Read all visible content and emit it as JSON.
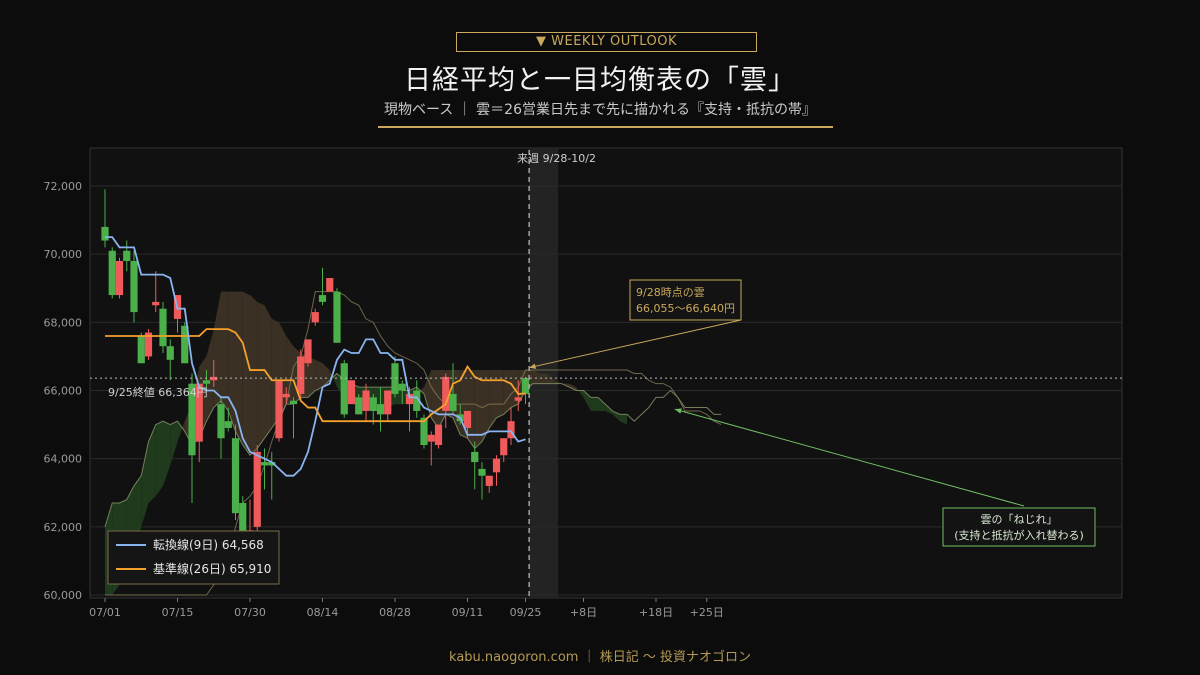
{
  "header": {
    "badge": "▼ WEEKLY OUTLOOK",
    "title": "日経平均と一目均衡表の「雲」",
    "subtitle": "現物ベース ｜ 雲＝26営業日先まで先に描かれる『支持・抵抗の帯』"
  },
  "footer": "kabu.naogoron.com ｜ 株日記 〜 投資ナオゴロン",
  "colors": {
    "up": "#f05a5a",
    "down": "#4cb04a",
    "tenkan": "#8ab4f0",
    "kijun": "#f5a02a",
    "bear_cloud": "#3a3124",
    "bull_cloud": "#1f3a1c",
    "accent": "#c9a95d"
  },
  "chart_data": {
    "type": "candlestick",
    "y_ticks": [
      "72,000",
      "70,000",
      "68,000",
      "66,000",
      "64,000",
      "62,000",
      "60,000"
    ],
    "ylim": [
      60000,
      73000
    ],
    "x_ticks": [
      {
        "label": "07/01",
        "i": 0
      },
      {
        "label": "07/15",
        "i": 10
      },
      {
        "label": "07/30",
        "i": 20
      },
      {
        "label": "08/14",
        "i": 30
      },
      {
        "label": "08/28",
        "i": 40
      },
      {
        "label": "09/11",
        "i": 50
      },
      {
        "label": "09/25",
        "i": 58
      },
      {
        "label": "+8日",
        "i": 66
      },
      {
        "label": "+18日",
        "i": 76
      },
      {
        "label": "+25日",
        "i": 83
      }
    ],
    "x_count": 85,
    "candles": [
      [
        70800,
        71900,
        70200,
        70400
      ],
      [
        70100,
        70200,
        68700,
        68800
      ],
      [
        68800,
        69900,
        68700,
        69800
      ],
      [
        70100,
        70400,
        69500,
        69800
      ],
      [
        69800,
        70100,
        68000,
        68300
      ],
      [
        67600,
        67700,
        66800,
        66800
      ],
      [
        67000,
        67800,
        66900,
        67700
      ],
      [
        68500,
        69500,
        68300,
        68600
      ],
      [
        68400,
        68600,
        67100,
        67300
      ],
      [
        67300,
        67500,
        66300,
        66900
      ],
      [
        68100,
        68800,
        67700,
        68800
      ],
      [
        67900,
        68000,
        66800,
        66800
      ],
      [
        66200,
        66500,
        62700,
        64100
      ],
      [
        64500,
        66200,
        63900,
        66200
      ],
      [
        66300,
        66600,
        66000,
        66200
      ],
      [
        66300,
        66900,
        66100,
        66400
      ],
      [
        65600,
        65800,
        64000,
        64600
      ],
      [
        65100,
        65500,
        64800,
        64900
      ],
      [
        64600,
        65000,
        62200,
        62400
      ],
      [
        62700,
        62900,
        60500,
        61800
      ],
      [
        61200,
        62800,
        60900,
        61900
      ],
      [
        62000,
        64400,
        61700,
        64200
      ],
      [
        63900,
        64300,
        63100,
        63800
      ],
      [
        63900,
        64200,
        62800,
        63800
      ],
      [
        64600,
        66300,
        64500,
        66300
      ],
      [
        65800,
        66100,
        65600,
        65900
      ],
      [
        65700,
        65800,
        64600,
        65600
      ],
      [
        65900,
        67200,
        65700,
        67000
      ],
      [
        66800,
        67500,
        66700,
        67500
      ],
      [
        68000,
        68400,
        67900,
        68300
      ],
      [
        68800,
        69600,
        68500,
        68600
      ],
      [
        68900,
        69300,
        68900,
        69300
      ],
      [
        68900,
        69000,
        67400,
        67400
      ],
      [
        66800,
        66900,
        65200,
        65300
      ],
      [
        65600,
        66300,
        65600,
        66300
      ],
      [
        65800,
        65900,
        65300,
        65300
      ],
      [
        65400,
        66200,
        65100,
        66000
      ],
      [
        65800,
        65900,
        65000,
        65400
      ],
      [
        65600,
        66100,
        64800,
        65300
      ],
      [
        65300,
        66000,
        65100,
        66000
      ],
      [
        66800,
        67000,
        65800,
        65900
      ],
      [
        66200,
        66300,
        65600,
        66000
      ],
      [
        65600,
        66100,
        64800,
        65900
      ],
      [
        66000,
        66300,
        65200,
        65400
      ],
      [
        65200,
        65300,
        64300,
        64400
      ],
      [
        64500,
        64800,
        63800,
        64700
      ],
      [
        64400,
        65000,
        64300,
        65000
      ],
      [
        65400,
        66500,
        64900,
        66400
      ],
      [
        65900,
        66800,
        65300,
        65400
      ],
      [
        65300,
        65600,
        65000,
        65100
      ],
      [
        64900,
        65400,
        64600,
        65400
      ],
      [
        64200,
        64500,
        63100,
        63900
      ],
      [
        63700,
        63900,
        62800,
        63500
      ],
      [
        63200,
        63400,
        63000,
        63500
      ],
      [
        63600,
        64100,
        63200,
        64000
      ],
      [
        64100,
        64600,
        63900,
        64600
      ],
      [
        64600,
        65500,
        64400,
        65100
      ],
      [
        65700,
        66300,
        65400,
        65800
      ],
      [
        66364,
        66400,
        65600,
        65900
      ]
    ],
    "tenkan": [
      [
        0,
        70500
      ],
      [
        1,
        70500
      ],
      [
        2,
        70200
      ],
      [
        3,
        70200
      ],
      [
        4,
        70200
      ],
      [
        5,
        69400
      ],
      [
        8,
        69400
      ],
      [
        9,
        69300
      ],
      [
        10,
        68400
      ],
      [
        11,
        68400
      ],
      [
        12,
        66800
      ],
      [
        13,
        66100
      ],
      [
        14,
        66000
      ],
      [
        15,
        66000
      ],
      [
        16,
        65800
      ],
      [
        17,
        65800
      ],
      [
        18,
        65400
      ],
      [
        19,
        64600
      ],
      [
        20,
        64200
      ],
      [
        21,
        64100
      ],
      [
        22,
        64000
      ],
      [
        23,
        63900
      ],
      [
        24,
        63700
      ],
      [
        25,
        63500
      ],
      [
        26,
        63500
      ],
      [
        27,
        63700
      ],
      [
        28,
        64200
      ],
      [
        29,
        65100
      ],
      [
        30,
        66100
      ],
      [
        31,
        66200
      ],
      [
        32,
        66900
      ],
      [
        33,
        67200
      ],
      [
        34,
        67100
      ],
      [
        35,
        67100
      ],
      [
        36,
        67500
      ],
      [
        37,
        67500
      ],
      [
        38,
        67100
      ],
      [
        39,
        67100
      ],
      [
        40,
        66900
      ],
      [
        41,
        66900
      ],
      [
        42,
        65800
      ],
      [
        43,
        65800
      ],
      [
        44,
        65500
      ],
      [
        45,
        65400
      ],
      [
        46,
        65300
      ],
      [
        47,
        65300
      ],
      [
        48,
        65300
      ],
      [
        49,
        65200
      ],
      [
        50,
        64700
      ],
      [
        51,
        64700
      ],
      [
        52,
        64700
      ],
      [
        53,
        64800
      ],
      [
        54,
        64800
      ],
      [
        55,
        64800
      ],
      [
        56,
        64800
      ],
      [
        57,
        64500
      ],
      [
        58,
        64568
      ]
    ],
    "kijun": [
      [
        0,
        67600
      ],
      [
        13,
        67600
      ],
      [
        14,
        67800
      ],
      [
        17,
        67800
      ],
      [
        18,
        67700
      ],
      [
        19,
        67400
      ],
      [
        20,
        66600
      ],
      [
        22,
        66600
      ],
      [
        23,
        66300
      ],
      [
        26,
        66300
      ],
      [
        27,
        65700
      ],
      [
        28,
        65500
      ],
      [
        29,
        65500
      ],
      [
        30,
        65100
      ],
      [
        44,
        65100
      ],
      [
        45,
        65300
      ],
      [
        47,
        65600
      ],
      [
        48,
        66200
      ],
      [
        49,
        66300
      ],
      [
        50,
        66700
      ],
      [
        51,
        66400
      ],
      [
        52,
        66300
      ],
      [
        55,
        66300
      ],
      [
        56,
        66200
      ],
      [
        57,
        65900
      ],
      [
        58,
        65910
      ]
    ],
    "senkou_a": [
      [
        0,
        62000
      ],
      [
        1,
        62700
      ],
      [
        2,
        62700
      ],
      [
        3,
        62800
      ],
      [
        4,
        63200
      ],
      [
        5,
        63500
      ],
      [
        6,
        64500
      ],
      [
        7,
        65000
      ],
      [
        8,
        65100
      ],
      [
        9,
        65000
      ],
      [
        10,
        65100
      ],
      [
        11,
        64800
      ],
      [
        12,
        64400
      ],
      [
        13,
        64600
      ],
      [
        14,
        65100
      ],
      [
        15,
        65500
      ],
      [
        16,
        65700
      ],
      [
        17,
        65400
      ],
      [
        18,
        64800
      ],
      [
        19,
        64400
      ],
      [
        20,
        64100
      ],
      [
        21,
        64300
      ],
      [
        22,
        64600
      ],
      [
        23,
        64900
      ],
      [
        24,
        65200
      ],
      [
        25,
        65600
      ],
      [
        26,
        65600
      ],
      [
        27,
        65800
      ],
      [
        28,
        65800
      ],
      [
        29,
        66000
      ],
      [
        30,
        66100
      ],
      [
        31,
        66300
      ],
      [
        32,
        66500
      ],
      [
        33,
        66300
      ],
      [
        34,
        66200
      ],
      [
        35,
        66100
      ],
      [
        36,
        66100
      ],
      [
        37,
        66100
      ],
      [
        38,
        66100
      ],
      [
        39,
        66100
      ],
      [
        40,
        66100
      ],
      [
        41,
        66000
      ],
      [
        42,
        66000
      ],
      [
        43,
        66100
      ],
      [
        44,
        65900
      ],
      [
        45,
        65200
      ],
      [
        46,
        64900
      ],
      [
        47,
        65300
      ],
      [
        48,
        65200
      ],
      [
        49,
        64700
      ],
      [
        50,
        64600
      ],
      [
        51,
        64300
      ],
      [
        52,
        64500
      ],
      [
        53,
        64900
      ],
      [
        54,
        65200
      ],
      [
        55,
        65300
      ],
      [
        56,
        65500
      ],
      [
        57,
        65600
      ],
      [
        58,
        66000
      ],
      [
        59,
        66200
      ],
      [
        60,
        66200
      ],
      [
        61,
        66200
      ],
      [
        62,
        66200
      ],
      [
        63,
        66200
      ],
      [
        64,
        66100
      ],
      [
        65,
        66000
      ],
      [
        66,
        66000
      ],
      [
        67,
        65800
      ],
      [
        68,
        65800
      ],
      [
        69,
        65600
      ],
      [
        70,
        65400
      ],
      [
        71,
        65300
      ],
      [
        72,
        65300
      ],
      [
        73,
        65100
      ],
      [
        74,
        65300
      ],
      [
        75,
        65500
      ],
      [
        76,
        65800
      ],
      [
        77,
        65800
      ],
      [
        78,
        66000
      ],
      [
        79,
        65800
      ],
      [
        80,
        65500
      ],
      [
        81,
        65500
      ],
      [
        82,
        65500
      ],
      [
        83,
        65500
      ],
      [
        84,
        65300
      ],
      [
        85,
        65300
      ]
    ],
    "senkou_b": [
      [
        0,
        60000
      ],
      [
        14,
        60000
      ],
      [
        15,
        60300
      ],
      [
        16,
        60500
      ],
      [
        17,
        61000
      ],
      [
        18,
        62000
      ],
      [
        19,
        62700
      ],
      [
        20,
        62900
      ],
      [
        21,
        63200
      ],
      [
        22,
        63800
      ],
      [
        23,
        64500
      ],
      [
        24,
        65100
      ],
      [
        25,
        65600
      ],
      [
        26,
        66700
      ],
      [
        27,
        67000
      ],
      [
        28,
        67800
      ],
      [
        29,
        68900
      ],
      [
        30,
        68900
      ],
      [
        31,
        68900
      ],
      [
        32,
        68900
      ],
      [
        33,
        68800
      ],
      [
        34,
        68600
      ],
      [
        35,
        68500
      ],
      [
        36,
        68100
      ],
      [
        37,
        68000
      ],
      [
        38,
        67600
      ],
      [
        39,
        67300
      ],
      [
        40,
        67100
      ],
      [
        41,
        67000
      ],
      [
        42,
        66900
      ],
      [
        43,
        66800
      ],
      [
        44,
        66600
      ],
      [
        45,
        66100
      ],
      [
        46,
        65800
      ],
      [
        47,
        65600
      ],
      [
        48,
        65600
      ],
      [
        49,
        65600
      ],
      [
        50,
        65600
      ],
      [
        51,
        65600
      ],
      [
        52,
        65500
      ],
      [
        53,
        65600
      ],
      [
        54,
        65600
      ],
      [
        55,
        65600
      ],
      [
        56,
        65900
      ],
      [
        57,
        66100
      ],
      [
        58,
        66600
      ],
      [
        59,
        66600
      ],
      [
        60,
        66600
      ],
      [
        61,
        66600
      ],
      [
        62,
        66600
      ],
      [
        63,
        66600
      ],
      [
        64,
        66600
      ],
      [
        65,
        66600
      ],
      [
        66,
        66600
      ],
      [
        67,
        66600
      ],
      [
        68,
        66600
      ],
      [
        69,
        66600
      ],
      [
        70,
        66600
      ],
      [
        71,
        66600
      ],
      [
        72,
        66600
      ],
      [
        73,
        66500
      ],
      [
        74,
        66500
      ],
      [
        75,
        66300
      ],
      [
        76,
        66200
      ],
      [
        77,
        66200
      ],
      [
        78,
        66100
      ],
      [
        79,
        65800
      ],
      [
        80,
        65400
      ],
      [
        81,
        65400
      ],
      [
        82,
        65400
      ],
      [
        83,
        65300
      ],
      [
        84,
        65100
      ],
      [
        85,
        65000
      ]
    ],
    "close_line": {
      "value": 66364,
      "label": "9/25終値 66,364円"
    },
    "next_week": {
      "label": "来週 9/28-10/2",
      "from": 58.5,
      "to": 62.5
    },
    "annotations": {
      "cloud_at_928": {
        "line1": "9/28時点の雲",
        "line2": "66,055〜66,640円"
      },
      "twist": {
        "line1": "雲の「ねじれ」",
        "line2": "(支持と抵抗が入れ替わる)"
      }
    },
    "legend": [
      {
        "name": "転換線(9日) 64,568",
        "color": "#8ab4f0"
      },
      {
        "name": "基準線(26日) 65,910",
        "color": "#f5a02a"
      }
    ]
  }
}
